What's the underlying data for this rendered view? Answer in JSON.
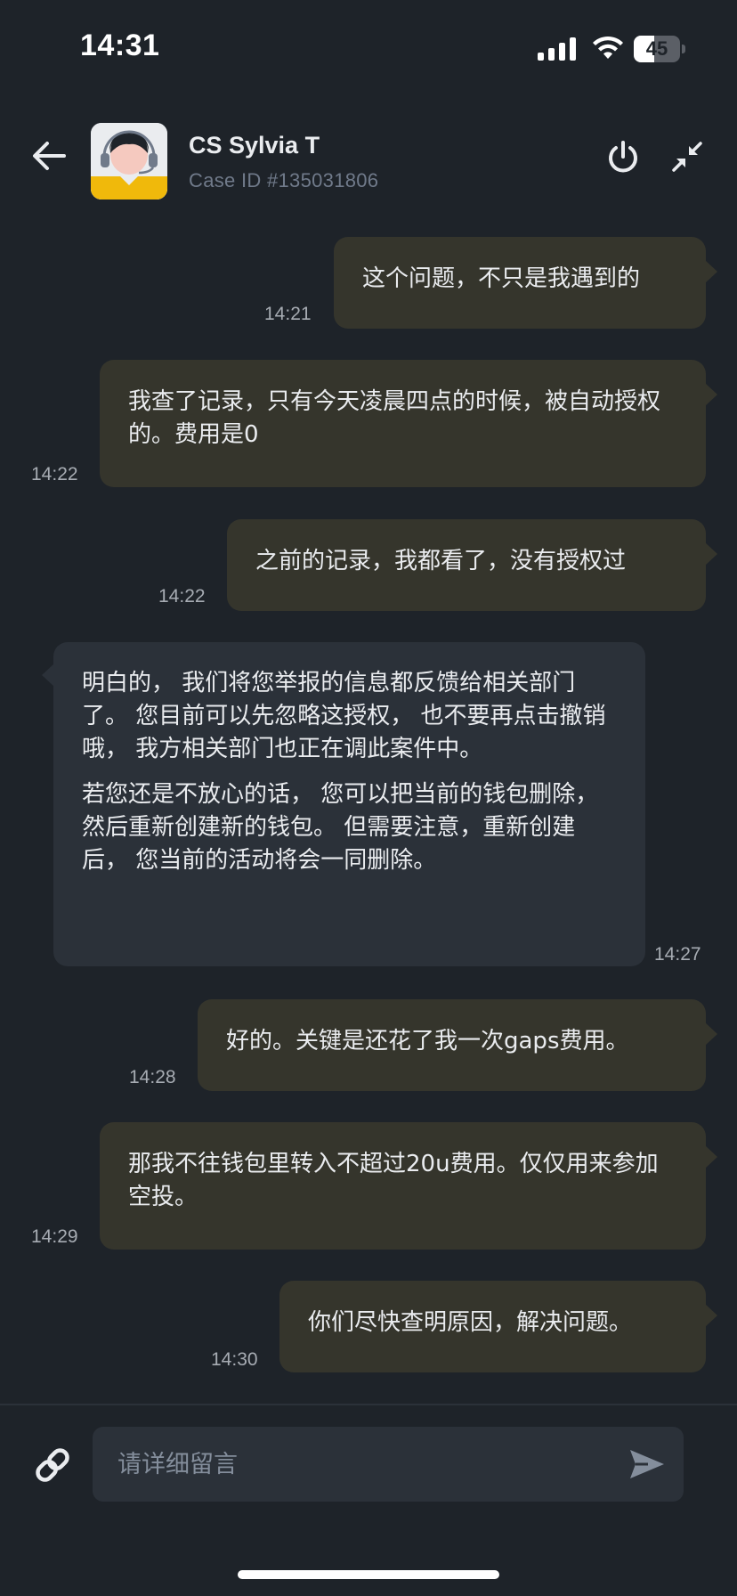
{
  "status_bar": {
    "time": "14:31",
    "battery_level": "45",
    "battery_fraction": 0.45
  },
  "header": {
    "agent_name": "CS Sylvia T",
    "case_id": "Case ID #135031806"
  },
  "messages": [
    {
      "sender": "user",
      "text": "这个问题，不只是我遇到的",
      "time": "14:21"
    },
    {
      "sender": "user",
      "text": "我查了记录，只有今天凌晨四点的时候，被自动授权的。费用是0",
      "time": "14:22"
    },
    {
      "sender": "user",
      "text": "之前的记录，我都看了，没有授权过",
      "time": "14:22"
    },
    {
      "sender": "agent",
      "paragraph1": "明白的， 我们将您举报的信息都反馈给相关部门了。 您目前可以先忽略这授权， 也不要再点击撤销哦， 我方相关部门也正在调此案件中。",
      "paragraph2": "若您还是不放心的话， 您可以把当前的钱包删除， 然后重新创建新的钱包。 但需要注意，重新创建后， 您当前的活动将会一同删除。",
      "time": "14:27"
    },
    {
      "sender": "user",
      "text": "好的。关键是还花了我一次gaps费用。",
      "time": "14:28"
    },
    {
      "sender": "user",
      "text": "那我不往钱包里转入不超过20u费用。仅仅用来参加空投。",
      "time": "14:29"
    },
    {
      "sender": "user",
      "text": "你们尽快查明原因，解决问题。",
      "time": "14:30"
    }
  ],
  "composer": {
    "placeholder": "请详细留言"
  },
  "colors": {
    "background": "#1e2329",
    "user_bubble": "#35352c",
    "agent_bubble": "#2b3139",
    "avatar_yellow": "#f0b90b"
  },
  "icons": {
    "back": "arrow-left-icon",
    "power": "power-icon",
    "minimize": "minimize-arrows-icon",
    "link": "link-icon",
    "send": "send-icon"
  }
}
